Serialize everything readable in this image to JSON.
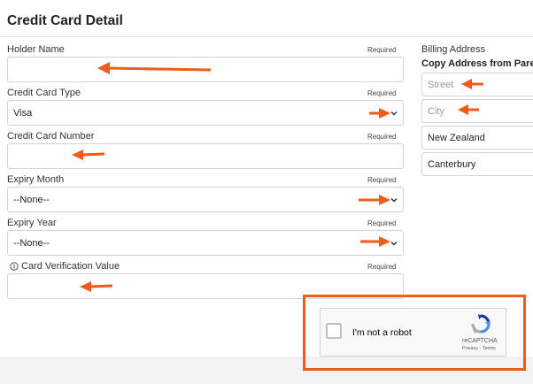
{
  "page": {
    "title": "Credit Card Detail"
  },
  "form": {
    "holder_name": {
      "label": "Holder Name",
      "required": "Required",
      "value": ""
    },
    "card_type": {
      "label": "Credit Card Type",
      "required": "Required",
      "value": "Visa"
    },
    "card_number": {
      "label": "Credit Card Number",
      "required": "Required",
      "value": ""
    },
    "expiry_month": {
      "label": "Expiry Month",
      "required": "Required",
      "value": "--None--"
    },
    "expiry_year": {
      "label": "Expiry Year",
      "required": "Required",
      "value": "--None--"
    },
    "cvv": {
      "label": "Card Verification Value",
      "required": "Required",
      "value": "",
      "info_icon": "info-icon"
    }
  },
  "billing": {
    "heading": "Billing Address",
    "copy_link": "Copy Address from Parent",
    "street": {
      "placeholder": "Street",
      "value": ""
    },
    "city": {
      "placeholder": "City",
      "value": ""
    },
    "country": {
      "value": "New Zealand"
    },
    "region": {
      "value": "Canterbury"
    }
  },
  "captcha": {
    "label": "I'm not a robot",
    "brand": "reCAPTCHA",
    "links": "Privacy - Terms"
  },
  "annotations": {
    "arrow_color": "#f05a1a",
    "outline_color": "#f05a1a"
  }
}
